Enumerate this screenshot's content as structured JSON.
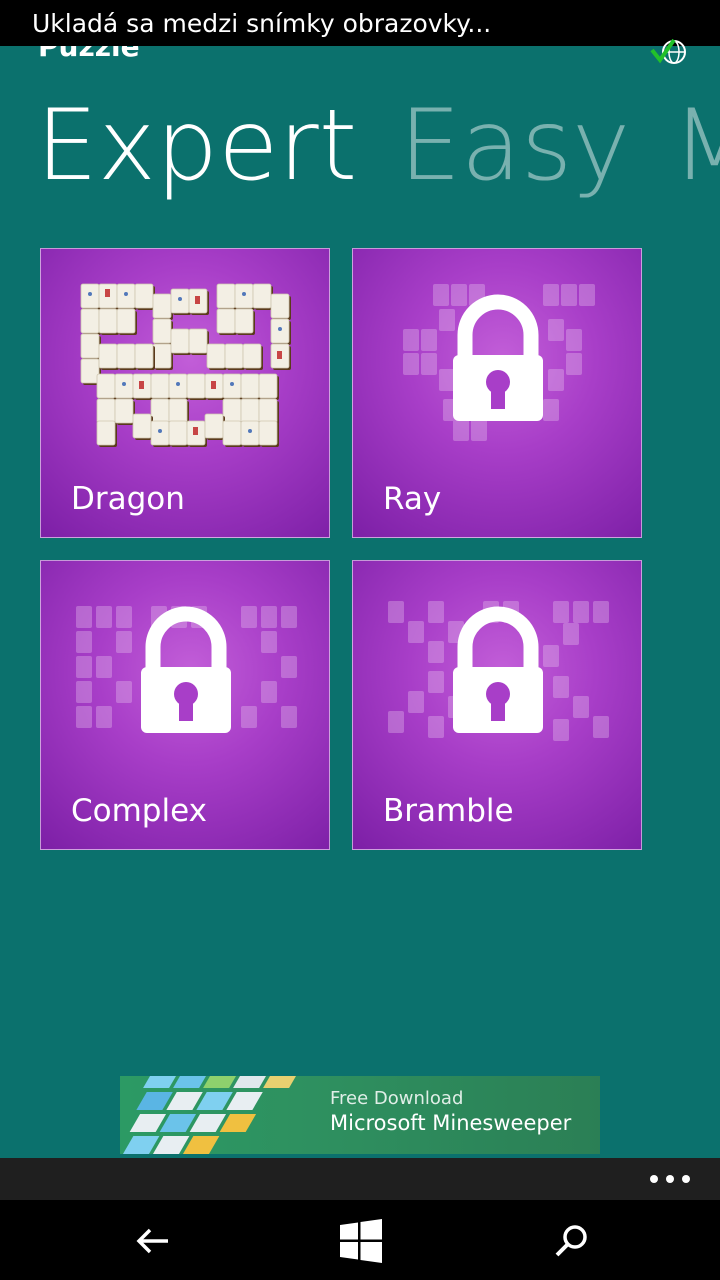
{
  "status": {
    "toast_text": "Ukladá sa medzi snímky obrazovky..."
  },
  "header": {
    "app_title": "Puzzle",
    "sync_icon": "globe-check-icon"
  },
  "pivot": {
    "tabs": [
      {
        "label": "Expert",
        "active": true
      },
      {
        "label": "Easy",
        "active": false
      },
      {
        "label": "M",
        "active": false
      }
    ]
  },
  "puzzles": [
    {
      "label": "Dragon",
      "locked": false
    },
    {
      "label": "Ray",
      "locked": true
    },
    {
      "label": "Complex",
      "locked": true
    },
    {
      "label": "Bramble",
      "locked": true
    }
  ],
  "ad": {
    "subtitle": "Free Download",
    "title": "Microsoft Minesweeper"
  },
  "appbar": {
    "more_icon": "ellipsis-icon"
  },
  "navbar": {
    "back_icon": "back-arrow-icon",
    "start_icon": "windows-start-icon",
    "search_icon": "search-icon"
  },
  "colors": {
    "background": "#0b716d",
    "tile": "#a83ec8",
    "appbar": "#1f1f1f"
  }
}
